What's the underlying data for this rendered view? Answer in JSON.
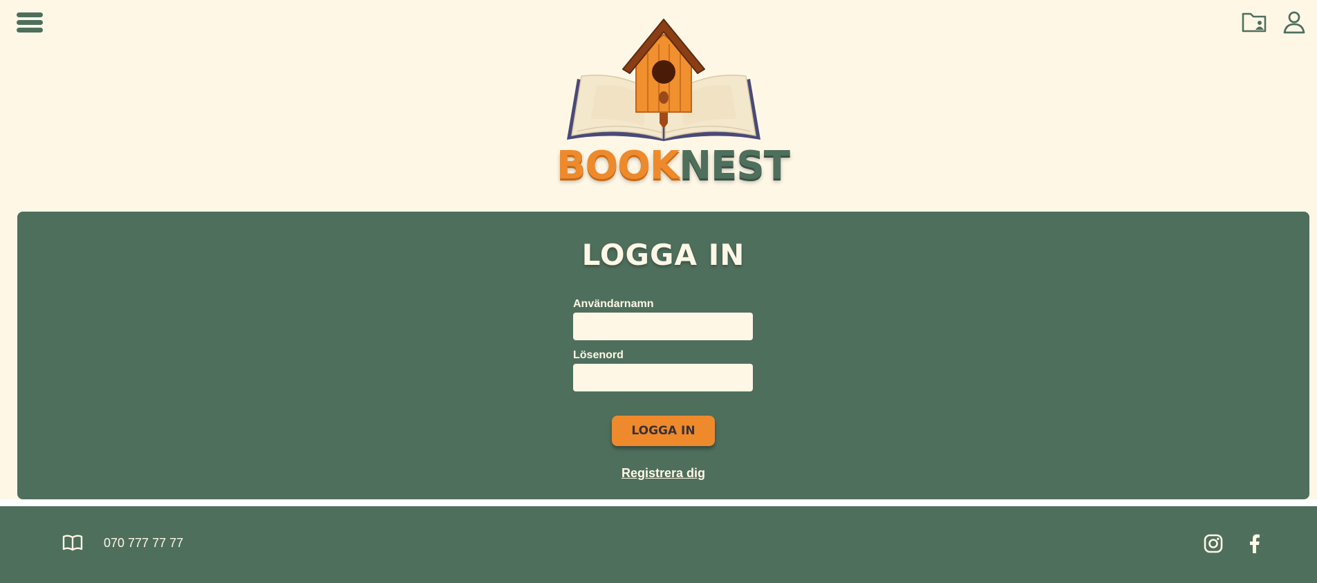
{
  "header": {
    "menu_icon": "hamburger-menu-icon",
    "right_icons": [
      "user-folder-icon",
      "user-icon"
    ]
  },
  "logo": {
    "word1": "BOOK",
    "word2": "NEST",
    "colors": {
      "book": "#ee8a2c",
      "nest": "#4f6f5d"
    }
  },
  "login": {
    "title": "LOGGA IN",
    "username_label": "Användarnamn",
    "username_value": "",
    "password_label": "Lösenord",
    "password_value": "",
    "submit_label": "LOGGA IN",
    "register_link": "Registrera dig"
  },
  "footer": {
    "contact_icon": "open-book-icon",
    "phone": "070 777 77 77",
    "social_icons": [
      "instagram-icon",
      "facebook-icon"
    ]
  },
  "colors": {
    "background": "#fff7e6",
    "primary_green": "#4f6f5d",
    "accent_orange": "#ee8a2c"
  }
}
